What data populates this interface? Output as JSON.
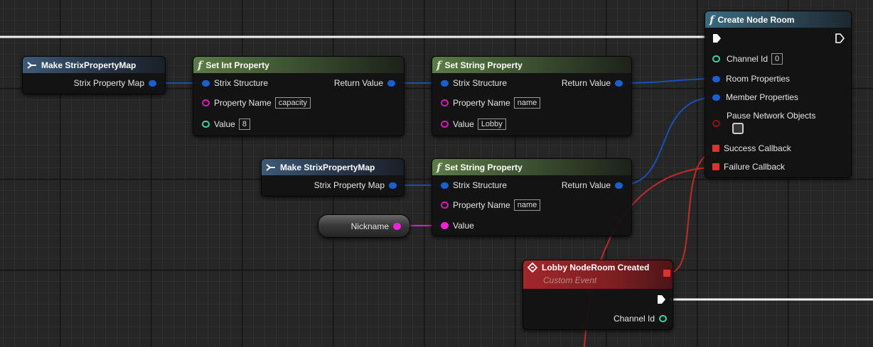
{
  "nodes": {
    "make_map_1": {
      "title": "Make StrixPropertyMap",
      "out_label": "Strix Property Map"
    },
    "set_int": {
      "title": "Set Int Property",
      "in_struct": "Strix Structure",
      "return_label": "Return Value",
      "prop_name_label": "Property Name",
      "prop_name_value": "capacity",
      "value_label": "Value",
      "value_value": "8"
    },
    "set_string_1": {
      "title": "Set String Property",
      "in_struct": "Strix Structure",
      "return_label": "Return Value",
      "prop_name_label": "Property Name",
      "prop_name_value": "name",
      "value_label": "Value",
      "value_value": "Lobby"
    },
    "make_map_2": {
      "title": "Make StrixPropertyMap",
      "out_label": "Strix Property Map"
    },
    "set_string_2": {
      "title": "Set String Property",
      "in_struct": "Strix Structure",
      "return_label": "Return Value",
      "prop_name_label": "Property Name",
      "prop_name_value": "name",
      "value_label": "Value"
    },
    "nickname": {
      "label": "Nickname"
    },
    "create_room": {
      "title": "Create Node Room",
      "channel_label": "Channel Id",
      "channel_value": "0",
      "room_props": "Room Properties",
      "member_props": "Member Properties",
      "pause_label": "Pause Network Objects",
      "pause_checked": false,
      "success_label": "Success Callback",
      "failure_label": "Failure Callback"
    },
    "custom_event": {
      "title": "Lobby NodeRoom Created",
      "subtitle": "Custom Event",
      "channel_label": "Channel Id"
    }
  },
  "colors": {
    "struct_pin": "#1b5fd6",
    "string_pin": "#d81ac0",
    "int_pin": "#39d6a0",
    "bool_pin": "#8a1515",
    "delegate_pin": "#e03030",
    "exec_wire": "#ffffff"
  }
}
